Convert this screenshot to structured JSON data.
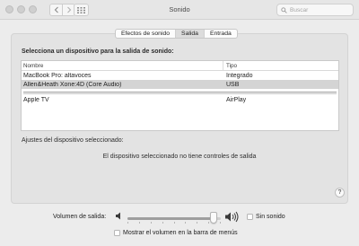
{
  "window": {
    "title": "Sonido"
  },
  "search": {
    "placeholder": "Buscar"
  },
  "tabs": [
    {
      "label": "Efectos de sonido",
      "active": false
    },
    {
      "label": "Salida",
      "active": true
    },
    {
      "label": "Entrada",
      "active": false
    }
  ],
  "output": {
    "section_label": "Selecciona un dispositivo para la salida de sonido:",
    "columns": {
      "name": "Nombre",
      "type": "Tipo"
    },
    "devices": [
      {
        "name": "MacBook Pro: altavoces",
        "type": "Integrado",
        "selected": false
      },
      {
        "name": "Allen&Heath Xone:4D (Core Audio)",
        "type": "USB",
        "selected": true
      },
      {
        "name": "Apple TV",
        "type": "AirPlay",
        "selected": false
      }
    ],
    "settings_label": "Ajustes del dispositivo seleccionado:",
    "no_controls_text": "El dispositivo seleccionado no tiene controles de salida",
    "help_label": "?"
  },
  "volume": {
    "label": "Volumen de salida:",
    "level": 0.92,
    "mute_label": "Sin sonido",
    "muted": false,
    "show_in_menubar_label": "Mostrar el volumen en la barra de menús",
    "show_in_menubar": false
  },
  "icons": {
    "back": "chevron-left-icon",
    "forward": "chevron-right-icon",
    "grid": "grid-icon",
    "search": "search-icon",
    "speaker_low": "speaker-low-icon",
    "speaker_high": "speaker-high-icon"
  },
  "colors": {
    "selected_row": "#d4d4d4",
    "panel": "#e3e3e3",
    "window": "#ececec"
  }
}
